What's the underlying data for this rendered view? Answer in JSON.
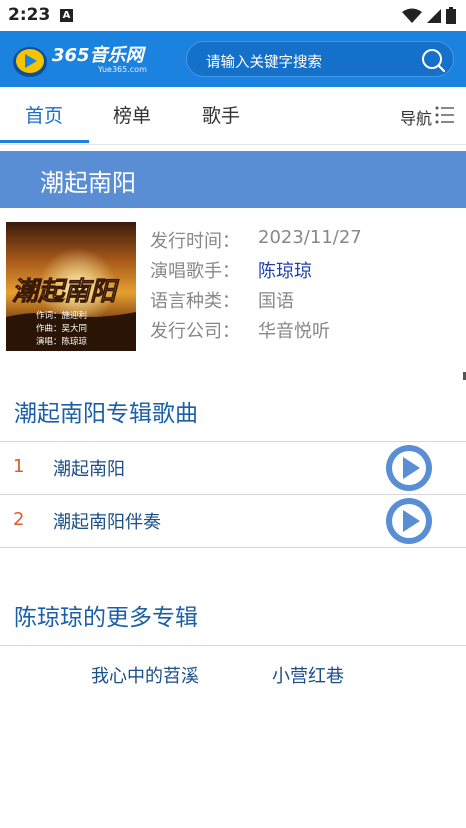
{
  "status_bar": {
    "time": "2:23",
    "notification_badge": "A",
    "icons": [
      "wifi-icon",
      "signal-icon",
      "battery-icon"
    ]
  },
  "header": {
    "logo_text": "365音乐网",
    "logo_sub": "Yue365.com",
    "search_placeholder": "请输入关键字搜索"
  },
  "nav": {
    "tabs": [
      {
        "label": "首页",
        "active": true
      },
      {
        "label": "榜单",
        "active": false
      },
      {
        "label": "歌手",
        "active": false
      }
    ],
    "menu_label": "导航"
  },
  "album": {
    "title": "潮起南阳",
    "cover": {
      "title": "潮起南阳",
      "credits": [
        "作词：施迎利",
        "作曲：吴大同",
        "演唱：陈琼琼"
      ]
    },
    "info": [
      {
        "label": "发行时间：",
        "value": "2023/11/27",
        "link": false
      },
      {
        "label": "演唱歌手：",
        "value": "陈琼琼",
        "link": true
      },
      {
        "label": "语言种类：",
        "value": "国语",
        "link": false
      },
      {
        "label": "发行公司：",
        "value": "华音悦听",
        "link": false
      }
    ]
  },
  "songs_section": {
    "title": "潮起南阳专辑歌曲",
    "songs": [
      {
        "num": "1",
        "name": "潮起南阳"
      },
      {
        "num": "2",
        "name": "潮起南阳伴奏"
      }
    ]
  },
  "more_section": {
    "title": "陈琼琼的更多专辑",
    "albums": [
      "我心中的苕溪",
      "小营红巷"
    ]
  },
  "colors": {
    "brand": "#1b82e0",
    "title_bar": "#5a8ed4",
    "song_number": "#e05a2a",
    "link": "#1b4f88"
  }
}
